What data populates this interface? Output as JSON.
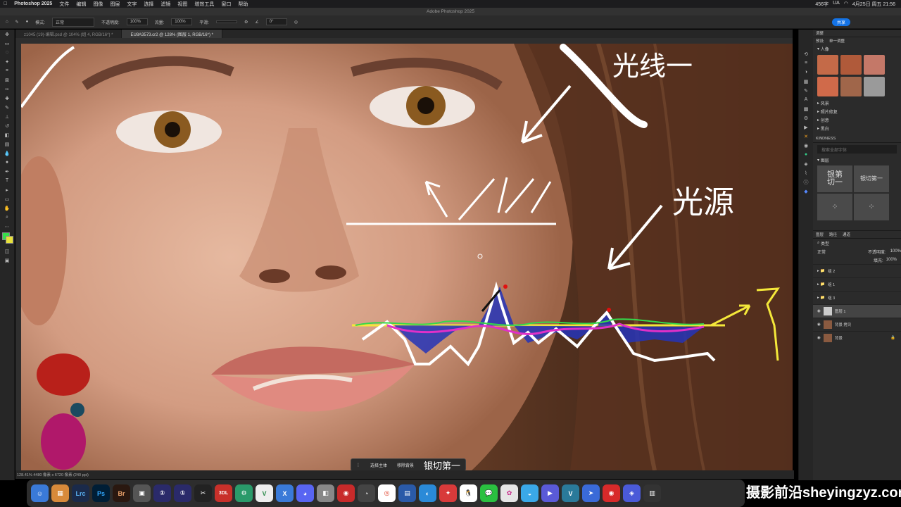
{
  "menubar": {
    "app": "Photoshop 2025",
    "items": [
      "文件",
      "编辑",
      "图像",
      "图层",
      "文字",
      "选择",
      "滤镜",
      "视图",
      "增效工具",
      "窗口",
      "帮助"
    ],
    "window_title": "Adobe Photoshop 2025",
    "datetime": "4月25日 周五 21:56",
    "wifi_label": "456字",
    "input_label": "UA"
  },
  "options": {
    "mode_label": "模式:",
    "mode_value": "正常",
    "opacity_label": "不透明度:",
    "opacity_value": "100%",
    "flow_label": "流量:",
    "flow_value": "100%",
    "smooth_label": "平滑:",
    "angle_value": "0°",
    "share_label": "共享"
  },
  "tabs": [
    {
      "label": "z1045 (19)-编辑.psd @ 104% (组 4, RGB/16*) *"
    },
    {
      "label": "EU8A3573.cr2 @ 128% (图层 1, RGB/16*) *"
    }
  ],
  "status": "128.41%   4480 像素 x 6720 像素 (240 ppi)",
  "context_bar": {
    "select_subject": "选择主体",
    "remove_bg": "移除背景"
  },
  "annotations": {
    "light_text": "光源",
    "shadow_text": "光线一",
    "bottom_text": "银切第一"
  },
  "panels": {
    "adjust_title": "调整",
    "adjust_tabs": [
      "预设",
      "单一调整"
    ],
    "portrait": "人像",
    "sections": [
      "风景",
      "照片修复",
      "创意",
      "黑白"
    ],
    "font_panel": "KINDNESS",
    "font_search": "搜索全部字体",
    "font_group": "图层",
    "font_samples": [
      "银第\n切一",
      "银切第一"
    ],
    "layers_tabs": [
      "图层",
      "路径",
      "通道"
    ],
    "blend": "正常",
    "layer_opacity_label": "不透明度:",
    "layer_opacity": "100%",
    "fill_label": "填充:",
    "fill": "100%",
    "kind": "类型",
    "layers": [
      {
        "name": "组 2"
      },
      {
        "name": "组 1"
      },
      {
        "name": "组 3"
      },
      {
        "name": "图层 1"
      },
      {
        "name": "背景 拷贝"
      },
      {
        "name": "背景"
      }
    ]
  },
  "dock": [
    "Lrc",
    "Ps",
    "Br",
    "3DL"
  ],
  "watermark": "摄影前沿sheyingzyz.com"
}
